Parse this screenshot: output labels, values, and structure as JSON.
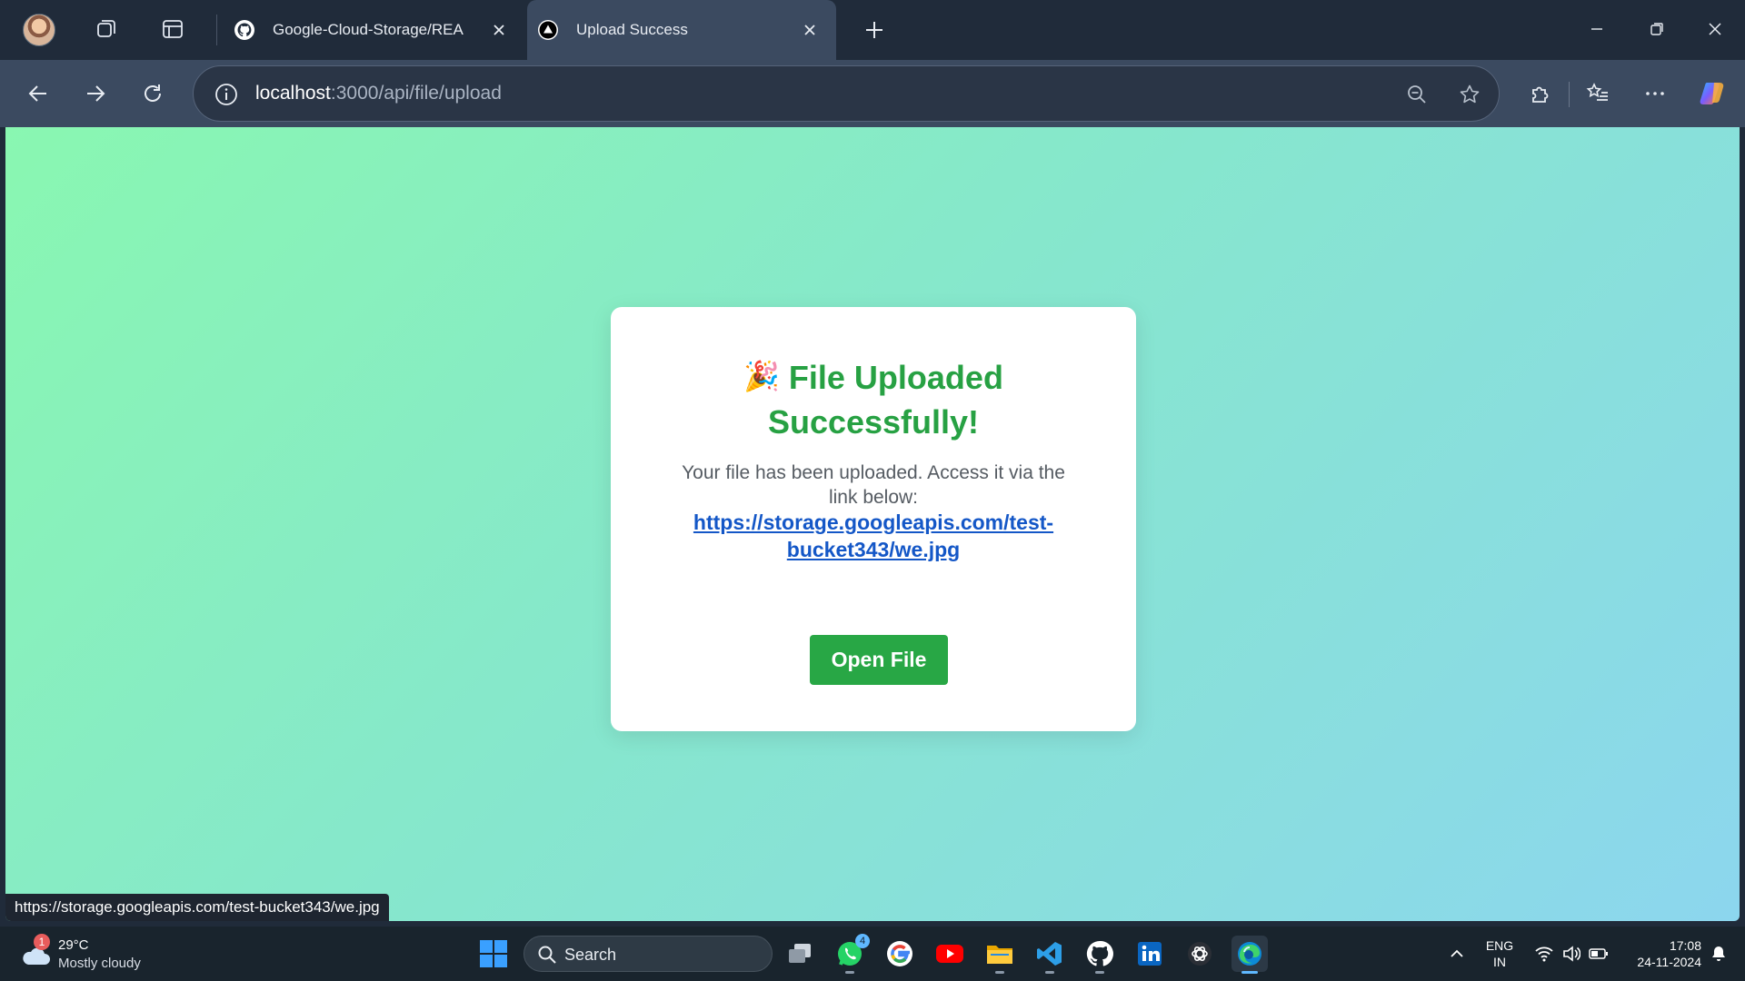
{
  "browser": {
    "tabs": [
      {
        "title": "Google-Cloud-Storage/REA",
        "icon": "github-icon"
      },
      {
        "title": "Upload Success",
        "icon": "nextjs-icon"
      }
    ],
    "url_host": "localhost",
    "url_path": ":3000/api/file/upload"
  },
  "page": {
    "title": "File Uploaded Successfully!",
    "emoji": "🎉",
    "message": "Your file has been uploaded. Access it via the link below:",
    "link_text": "https://storage.googleapis.com/test-bucket343/we.jpg",
    "button_label": "Open File",
    "status_url": "https://storage.googleapis.com/test-bucket343/we.jpg",
    "colors": {
      "title": "#27a143",
      "button": "#28a745",
      "link": "#1457c7"
    }
  },
  "taskbar": {
    "weather_temp": "29°C",
    "weather_desc": "Mostly cloudy",
    "weather_badge": "1",
    "search_label": "Search",
    "whatsapp_badge": "4",
    "lang_line1": "ENG",
    "lang_line2": "IN",
    "time": "17:08",
    "date": "24-11-2024"
  }
}
